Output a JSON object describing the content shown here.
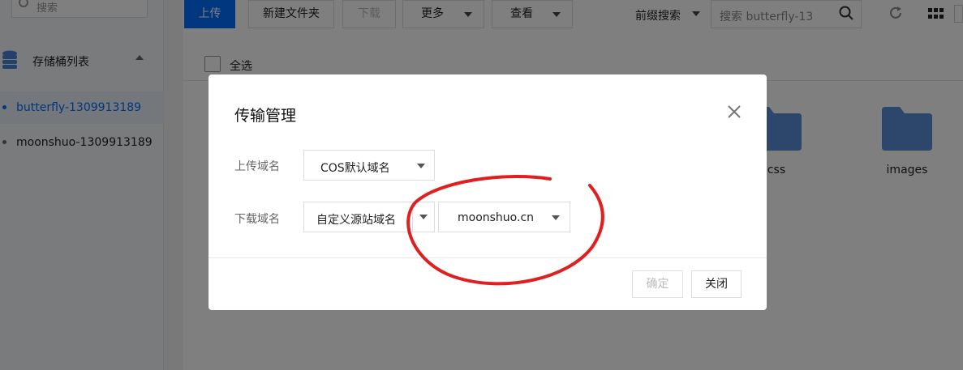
{
  "sidebar": {
    "search_placeholder": "搜索",
    "section_label": "存储桶列表",
    "items": [
      {
        "label": "butterfly-1309913189",
        "active": true
      },
      {
        "label": "moonshuo-1309913189",
        "active": false
      }
    ]
  },
  "toolbar": {
    "upload": "上传",
    "new_folder": "新建文件夹",
    "download": "下载",
    "more": "更多",
    "view": "查看",
    "prefix_search": "前缀搜索",
    "search_placeholder": "搜索 butterfly-13"
  },
  "file_list": {
    "select_all": "全选",
    "folders": [
      "css",
      "images"
    ]
  },
  "modal": {
    "title": "传输管理",
    "upload_domain_label": "上传域名",
    "upload_domain_value": "COS默认域名",
    "download_domain_label": "下载域名",
    "download_domain_type": "自定义源站域名",
    "download_domain_value": "moonshuo.cn",
    "confirm": "确定",
    "close": "关闭"
  },
  "colors": {
    "accent": "#006eff",
    "annotation": "#e02020",
    "folder": "#5b8ed8"
  }
}
